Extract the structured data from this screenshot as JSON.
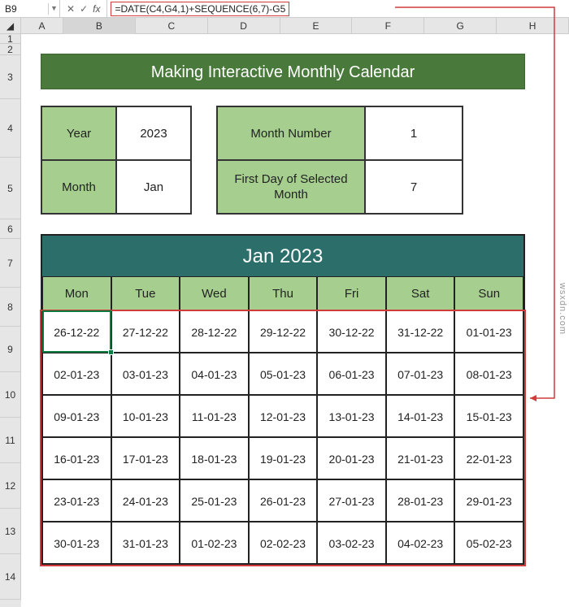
{
  "namebox": "B9",
  "formula": "=DATE(C4,G4,1)+SEQUENCE(6,7)-G5",
  "columns": [
    "A",
    "B",
    "C",
    "D",
    "E",
    "F",
    "G",
    "H"
  ],
  "rows": [
    "1",
    "2",
    "3",
    "4",
    "5",
    "6",
    "7",
    "8",
    "9",
    "10",
    "11",
    "12",
    "13",
    "14"
  ],
  "title": "Making Interactive Monthly Calendar",
  "params_left": {
    "year_label": "Year",
    "year_value": "2023",
    "month_label": "Month",
    "month_value": "Jan"
  },
  "params_right": {
    "mn_label": "Month Number",
    "mn_value": "1",
    "fd_label": "First Day of Selected Month",
    "fd_value": "7"
  },
  "cal_title": "Jan 2023",
  "weekdays": [
    "Mon",
    "Tue",
    "Wed",
    "Thu",
    "Fri",
    "Sat",
    "Sun"
  ],
  "chart_data": {
    "type": "table",
    "title": "Jan 2023",
    "columns": [
      "Mon",
      "Tue",
      "Wed",
      "Thu",
      "Fri",
      "Sat",
      "Sun"
    ],
    "rows": [
      [
        "26-12-22",
        "27-12-22",
        "28-12-22",
        "29-12-22",
        "30-12-22",
        "31-12-22",
        "01-01-23"
      ],
      [
        "02-01-23",
        "03-01-23",
        "04-01-23",
        "05-01-23",
        "06-01-23",
        "07-01-23",
        "08-01-23"
      ],
      [
        "09-01-23",
        "10-01-23",
        "11-01-23",
        "12-01-23",
        "13-01-23",
        "14-01-23",
        "15-01-23"
      ],
      [
        "16-01-23",
        "17-01-23",
        "18-01-23",
        "19-01-23",
        "20-01-23",
        "21-01-23",
        "22-01-23"
      ],
      [
        "23-01-23",
        "24-01-23",
        "25-01-23",
        "26-01-23",
        "27-01-23",
        "28-01-23",
        "29-01-23"
      ],
      [
        "30-01-23",
        "31-01-23",
        "01-02-23",
        "02-02-23",
        "03-02-23",
        "04-02-23",
        "05-02-23"
      ]
    ]
  },
  "watermark": "wsxdn.com"
}
